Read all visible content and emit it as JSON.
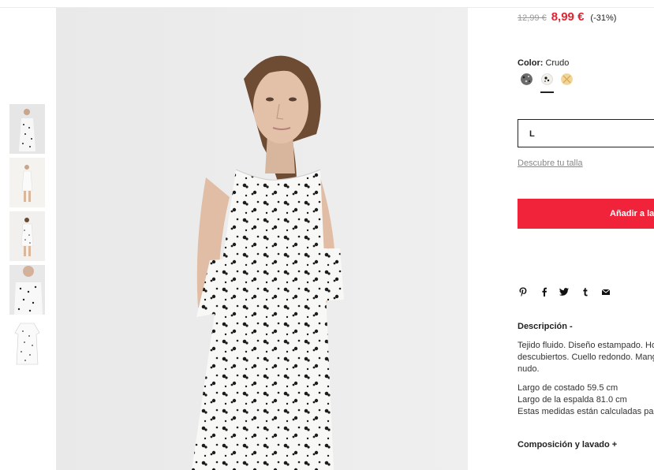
{
  "product": {
    "old_price": "12,99 €",
    "new_price": "8,99 €",
    "discount": "(-31%)",
    "color_label": "Color:",
    "color_value": "Crudo",
    "swatch_colors": [
      "#6a6a6a",
      "#f2f0ea",
      "#efd79a"
    ],
    "size_value": "L",
    "find_size": "Descubre tu talla",
    "add_to_bag": "Añadir a la bolsa",
    "accent_color": "#f0233b",
    "price_color": "#e5202f"
  },
  "share": {
    "icons": [
      "pinterest-icon",
      "facebook-icon",
      "twitter-icon",
      "tumblr-icon",
      "email-icon"
    ]
  },
  "description": {
    "title": "Descripción -",
    "lines": [
      "Tejido fluido. Diseño estampado. Hombros",
      "descubiertos. Cuello redondo. Mangas cortas con",
      "nudo."
    ],
    "measures": [
      "Largo de costado 59.5 cm",
      "Largo de la espalda 81.0 cm",
      "Estas medidas están calculadas para una talla M"
    ]
  },
  "composition": {
    "title": "Composición y lavado +"
  },
  "gallery": {
    "thumbnails": [
      "thumbnail-front-closeup",
      "thumbnail-full-body",
      "thumbnail-back",
      "thumbnail-shoulder-detail",
      "thumbnail-flat-garment"
    ]
  }
}
